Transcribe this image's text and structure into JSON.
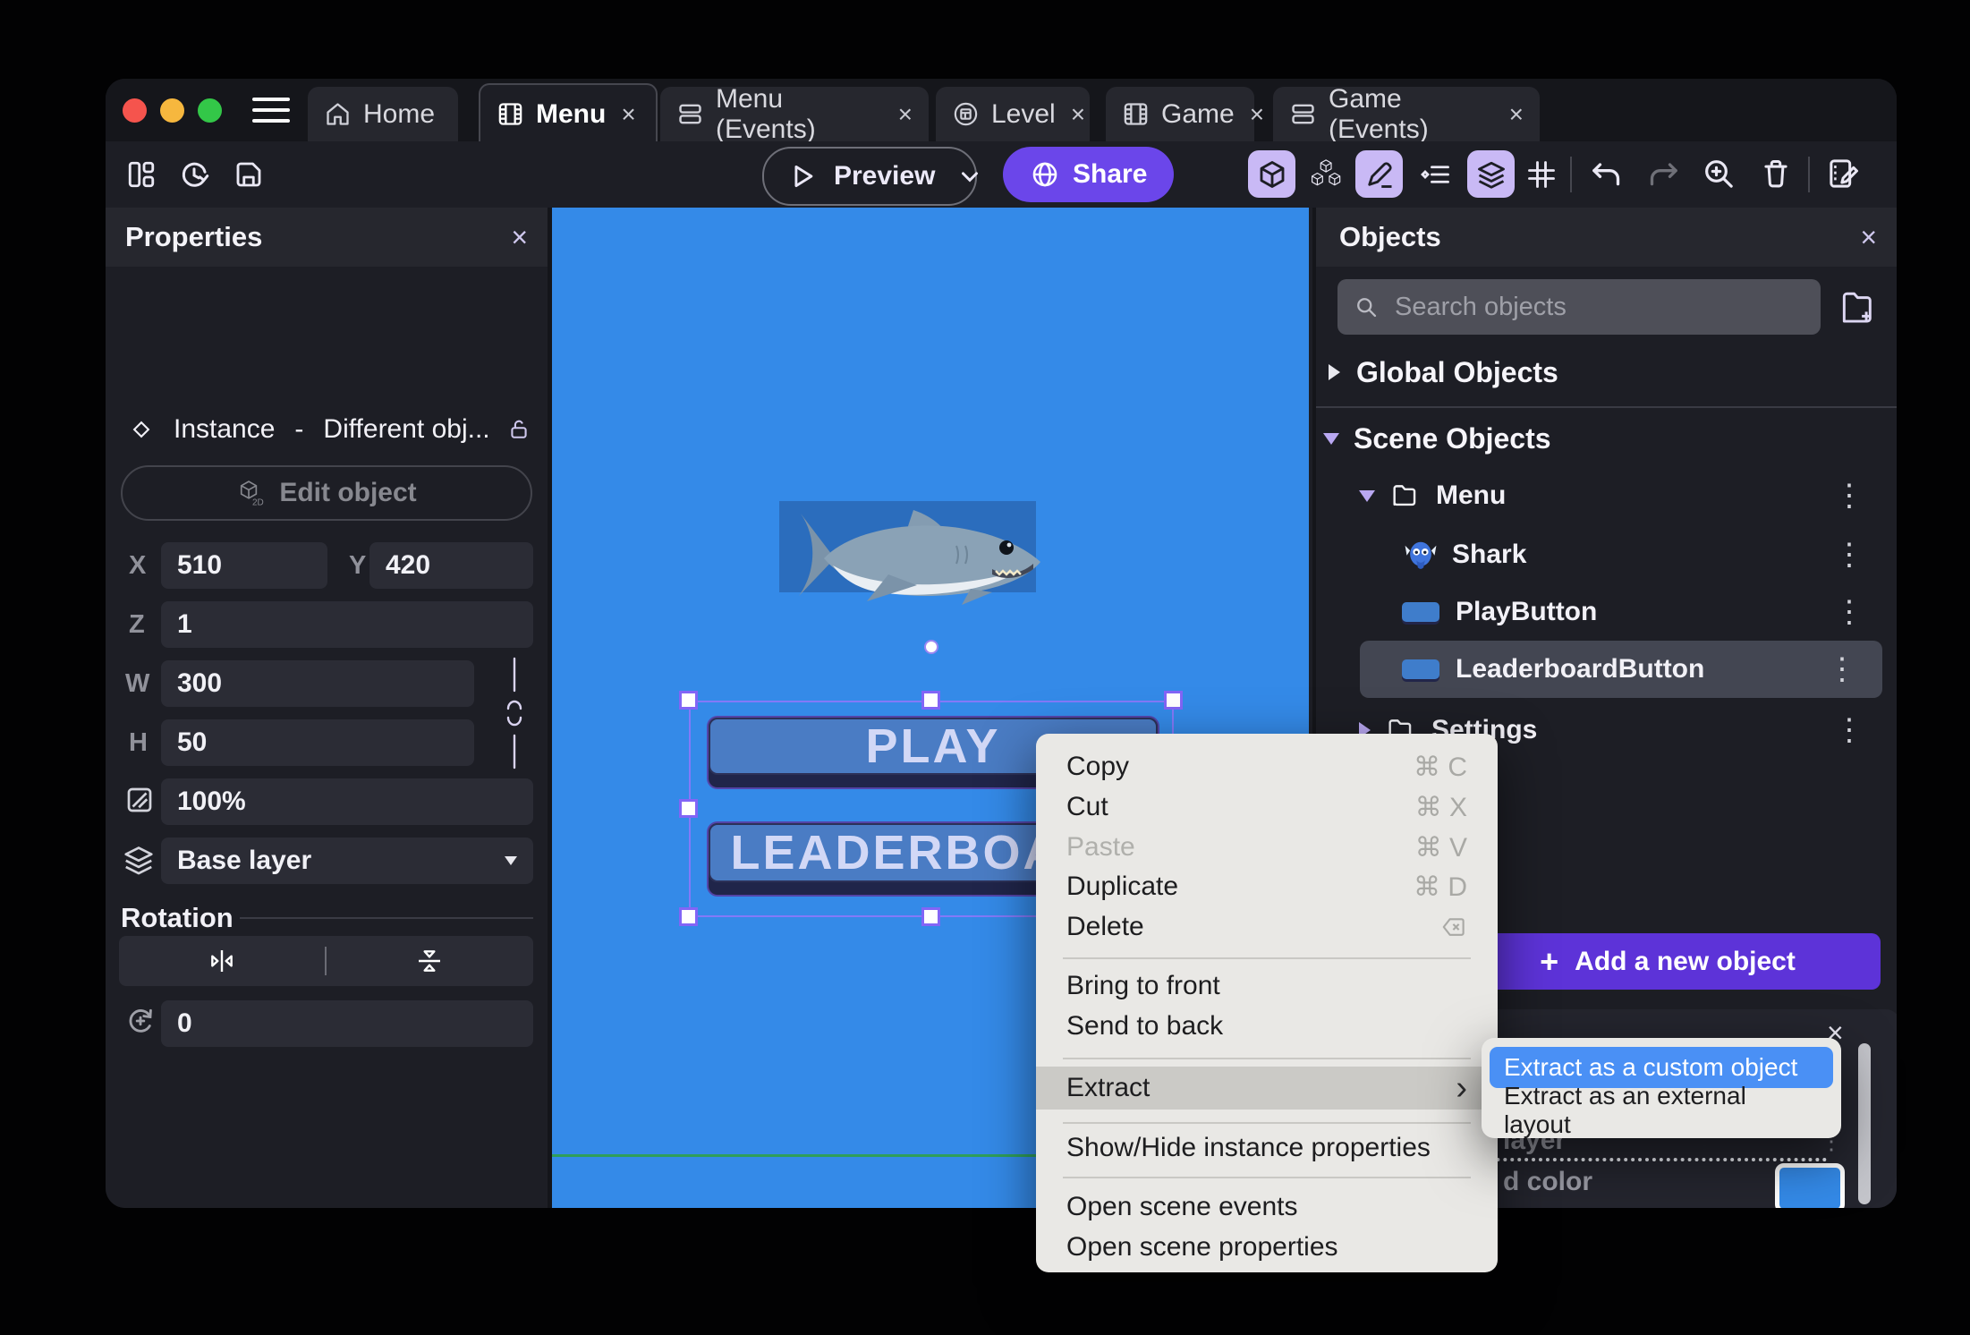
{
  "tabs": {
    "home": {
      "label": "Home"
    },
    "menu": {
      "label": "Menu",
      "close": "×"
    },
    "menu_events": {
      "label": "Menu (Events)",
      "close": "×"
    },
    "level": {
      "label": "Level",
      "close": "×"
    },
    "game": {
      "label": "Game",
      "close": "×"
    },
    "game_events": {
      "label": "Game (Events)",
      "close": "×"
    }
  },
  "toolbar": {
    "preview": "Preview",
    "share": "Share"
  },
  "properties": {
    "title": "Properties",
    "close": "×",
    "instance_label": "Instance",
    "dash": "-",
    "instance_object": "Different obj...",
    "edit_object": "Edit object",
    "x_label": "X",
    "x": "510",
    "y_label": "Y",
    "y": "420",
    "z_label": "Z",
    "z": "1",
    "w_label": "W",
    "w": "300",
    "h_label": "H",
    "h": "50",
    "opacity": "100%",
    "layer": "Base layer",
    "rotation_title": "Rotation",
    "rotation": "0"
  },
  "canvas": {
    "play": "PLAY",
    "leaderboard": "LEADERBOARD"
  },
  "objects": {
    "title": "Objects",
    "close": "×",
    "search_placeholder": "Search objects",
    "global": "Global Objects",
    "scene": "Scene Objects",
    "items": [
      {
        "label": "Menu"
      },
      {
        "label": "Shark"
      },
      {
        "label": "PlayButton"
      },
      {
        "label": "LeaderboardButton"
      },
      {
        "label": "Settings"
      }
    ],
    "plus": "+",
    "add_object": "Add a new object"
  },
  "bottom_panel": {
    "close": "×",
    "layer_fragment": "layer",
    "color_fragment": "d color",
    "kebab": "⋮",
    "swatch_color": "#348ae8"
  },
  "context_menu": {
    "copy": {
      "label": "Copy",
      "shortcut": "⌘ C"
    },
    "cut": {
      "label": "Cut",
      "shortcut": "⌘ X"
    },
    "paste": {
      "label": "Paste",
      "shortcut": "⌘ V"
    },
    "duplicate": {
      "label": "Duplicate",
      "shortcut": "⌘ D"
    },
    "delete": {
      "label": "Delete"
    },
    "bring_to_front": {
      "label": "Bring to front"
    },
    "send_to_back": {
      "label": "Send to back"
    },
    "extract": {
      "label": "Extract",
      "chevron": "›"
    },
    "show_hide": {
      "label": "Show/Hide instance properties"
    },
    "open_events": {
      "label": "Open scene events"
    },
    "open_props": {
      "label": "Open scene properties"
    }
  },
  "submenu": {
    "custom_object": "Extract as a custom object",
    "external_layout": "Extract as an external layout"
  },
  "colors": {
    "accent_purple": "#6b46ea",
    "add_button_purple": "#5d33d8",
    "submenu_highlight": "#4a90f5",
    "selection_purple": "#7d5cf5",
    "canvas_blue": "#348ae8",
    "traffic_red": "#f5544d",
    "traffic_yellow": "#f6b73e",
    "traffic_green": "#33c748"
  }
}
